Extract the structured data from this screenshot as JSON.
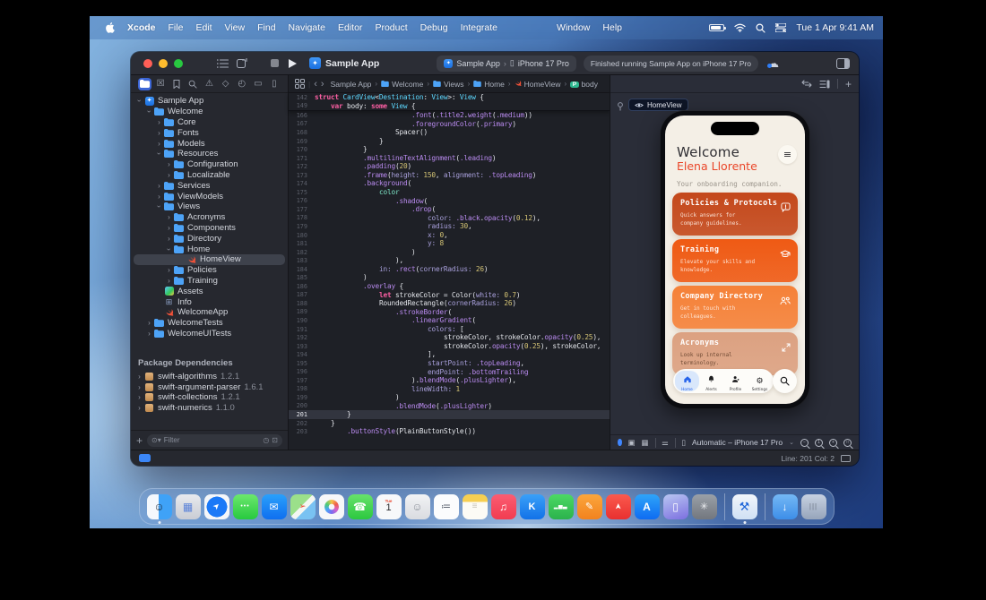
{
  "menubar": {
    "items": [
      "Xcode",
      "File",
      "Edit",
      "View",
      "Find",
      "Navigate",
      "Editor",
      "Product",
      "Debug",
      "Integrate",
      "Window",
      "Help"
    ],
    "clock": "Tue 1 Apr  9:41 AM",
    "status_icons": [
      "battery-icon",
      "wifi-icon",
      "search-icon",
      "control-center-icon"
    ]
  },
  "window": {
    "title": "Sample App",
    "toolbar": {
      "scheme_app": "Sample App",
      "scheme_device": "iPhone 17 Pro",
      "status": "Finished running Sample App on iPhone 17 Pro"
    },
    "navigator": {
      "tabs": [
        "project",
        "source-control",
        "bookmarks",
        "find",
        "issues",
        "tests",
        "debug",
        "breakpoints",
        "reports"
      ],
      "tree": [
        {
          "label": "Sample App",
          "lvl": 0,
          "disc": "open",
          "icon": "project"
        },
        {
          "label": "Welcome",
          "lvl": 1,
          "disc": "open",
          "icon": "folder"
        },
        {
          "label": "Core",
          "lvl": 2,
          "disc": "closed",
          "icon": "folder"
        },
        {
          "label": "Fonts",
          "lvl": 2,
          "disc": "closed",
          "icon": "folder"
        },
        {
          "label": "Models",
          "lvl": 2,
          "disc": "closed",
          "icon": "folder"
        },
        {
          "label": "Resources",
          "lvl": 2,
          "disc": "open",
          "icon": "folder"
        },
        {
          "label": "Configuration",
          "lvl": 3,
          "disc": "closed",
          "icon": "folder"
        },
        {
          "label": "Localizable",
          "lvl": 3,
          "disc": "closed",
          "icon": "folder"
        },
        {
          "label": "Services",
          "lvl": 2,
          "disc": "closed",
          "icon": "folder"
        },
        {
          "label": "ViewModels",
          "lvl": 2,
          "disc": "closed",
          "icon": "folder"
        },
        {
          "label": "Views",
          "lvl": 2,
          "disc": "open",
          "icon": "folder"
        },
        {
          "label": "Acronyms",
          "lvl": 3,
          "disc": "closed",
          "icon": "folder"
        },
        {
          "label": "Components",
          "lvl": 3,
          "disc": "closed",
          "icon": "folder"
        },
        {
          "label": "Directory",
          "lvl": 3,
          "disc": "closed",
          "icon": "folder"
        },
        {
          "label": "Home",
          "lvl": 3,
          "disc": "open",
          "icon": "folder"
        },
        {
          "label": "HomeView",
          "lvl": 4,
          "disc": "none",
          "icon": "swift",
          "selected": true
        },
        {
          "label": "Policies",
          "lvl": 3,
          "disc": "closed",
          "icon": "folder"
        },
        {
          "label": "Training",
          "lvl": 3,
          "disc": "closed",
          "icon": "folder"
        },
        {
          "label": "Assets",
          "lvl": 2,
          "disc": "none",
          "icon": "assets"
        },
        {
          "label": "Info",
          "lvl": 2,
          "disc": "none",
          "icon": "info"
        },
        {
          "label": "WelcomeApp",
          "lvl": 2,
          "disc": "none",
          "icon": "swift"
        },
        {
          "label": "WelcomeTests",
          "lvl": 1,
          "disc": "closed",
          "icon": "folder"
        },
        {
          "label": "WelcomeUITests",
          "lvl": 1,
          "disc": "closed",
          "icon": "folder"
        }
      ],
      "packages_header": "Package Dependencies",
      "packages": [
        {
          "label": "swift-algorithms",
          "version": "1.2.1"
        },
        {
          "label": "swift-argument-parser",
          "version": "1.6.1"
        },
        {
          "label": "swift-collections",
          "version": "1.2.1"
        },
        {
          "label": "swift-numerics",
          "version": "1.1.0"
        }
      ],
      "filter_placeholder": "Filter"
    },
    "jumpbar": {
      "crumbs": [
        {
          "icon": "project",
          "label": "Sample App"
        },
        {
          "icon": "folder",
          "label": "Welcome"
        },
        {
          "icon": "folder",
          "label": "Views"
        },
        {
          "icon": "folder",
          "label": "Home"
        },
        {
          "icon": "swift",
          "label": "HomeView"
        },
        {
          "icon": "property",
          "label": "body"
        }
      ]
    },
    "editor": {
      "current_line": 201,
      "sticky": [
        {
          "n": 142,
          "i": 0,
          "s": [
            [
              "k",
              "struct "
            ],
            [
              "t",
              "CardView"
            ],
            [
              "p",
              "<"
            ],
            [
              "t",
              "Destination"
            ],
            [
              "p",
              ": "
            ],
            [
              "t",
              "View"
            ],
            [
              "p",
              ">: "
            ],
            [
              "t",
              "View"
            ],
            [
              "p",
              " {"
            ]
          ]
        },
        {
          "n": 149,
          "i": 4,
          "s": [
            [
              "k",
              "var"
            ],
            [
              "p",
              " body: "
            ],
            [
              "k",
              "some"
            ],
            [
              "p",
              " "
            ],
            [
              "t",
              "View"
            ],
            [
              "p",
              " {"
            ]
          ]
        }
      ],
      "lines": [
        {
          "n": 166,
          "i": 24,
          "s": [
            [
              "m",
              ".font"
            ],
            [
              "p",
              "("
            ],
            [
              "m",
              ".title2"
            ],
            [
              "p",
              "."
            ],
            [
              "m",
              "weight"
            ],
            [
              "p",
              "("
            ],
            [
              "m",
              ".medium"
            ],
            [
              "p",
              "))"
            ]
          ]
        },
        {
          "n": 167,
          "i": 24,
          "s": [
            [
              "m",
              ".foregroundColor"
            ],
            [
              "p",
              "("
            ],
            [
              "m",
              ".primary"
            ],
            [
              "p",
              ")"
            ]
          ]
        },
        {
          "n": 168,
          "i": 20,
          "s": [
            [
              "p",
              "Spacer()"
            ]
          ]
        },
        {
          "n": 169,
          "i": 16,
          "s": [
            [
              "p",
              "}"
            ]
          ]
        },
        {
          "n": 170,
          "i": 12,
          "s": [
            [
              "p",
              "}"
            ]
          ]
        },
        {
          "n": 171,
          "i": 12,
          "s": [
            [
              "m",
              ".multilineTextAlignment"
            ],
            [
              "p",
              "("
            ],
            [
              "m",
              ".leading"
            ],
            [
              "p",
              ")"
            ]
          ]
        },
        {
          "n": 172,
          "i": 12,
          "s": [
            [
              "m",
              ".padding"
            ],
            [
              "p",
              "("
            ],
            [
              "n",
              "20"
            ],
            [
              "p",
              ")"
            ]
          ]
        },
        {
          "n": 173,
          "i": 12,
          "s": [
            [
              "m",
              ".frame"
            ],
            [
              "p",
              "("
            ],
            [
              "l",
              "height: "
            ],
            [
              "n",
              "150"
            ],
            [
              "p",
              ", "
            ],
            [
              "l",
              "alignment: "
            ],
            [
              "m",
              ".topLeading"
            ],
            [
              "p",
              ")"
            ]
          ]
        },
        {
          "n": 174,
          "i": 12,
          "s": [
            [
              "m",
              ".background"
            ],
            [
              "p",
              "("
            ]
          ]
        },
        {
          "n": 175,
          "i": 16,
          "s": [
            [
              "v",
              "color"
            ]
          ]
        },
        {
          "n": 176,
          "i": 20,
          "s": [
            [
              "m",
              ".shadow"
            ],
            [
              "p",
              "("
            ]
          ]
        },
        {
          "n": 177,
          "i": 24,
          "s": [
            [
              "m",
              ".drop"
            ],
            [
              "p",
              "("
            ]
          ]
        },
        {
          "n": 178,
          "i": 28,
          "s": [
            [
              "l",
              "color: "
            ],
            [
              "m",
              ".black"
            ],
            [
              "p",
              "."
            ],
            [
              "m",
              "opacity"
            ],
            [
              "p",
              "("
            ],
            [
              "n",
              "0.12"
            ],
            [
              "p",
              "),"
            ]
          ]
        },
        {
          "n": 179,
          "i": 28,
          "s": [
            [
              "l",
              "radius: "
            ],
            [
              "n",
              "30"
            ],
            [
              "p",
              ","
            ]
          ]
        },
        {
          "n": 180,
          "i": 28,
          "s": [
            [
              "l",
              "x: "
            ],
            [
              "n",
              "0"
            ],
            [
              "p",
              ","
            ]
          ]
        },
        {
          "n": 181,
          "i": 28,
          "s": [
            [
              "l",
              "y: "
            ],
            [
              "n",
              "8"
            ]
          ]
        },
        {
          "n": 182,
          "i": 24,
          "s": [
            [
              "p",
              ")"
            ]
          ]
        },
        {
          "n": 183,
          "i": 20,
          "s": [
            [
              "p",
              "),"
            ]
          ]
        },
        {
          "n": 184,
          "i": 16,
          "s": [
            [
              "l",
              "in: "
            ],
            [
              "m",
              ".rect"
            ],
            [
              "p",
              "("
            ],
            [
              "l",
              "cornerRadius: "
            ],
            [
              "n",
              "26"
            ],
            [
              "p",
              ")"
            ]
          ]
        },
        {
          "n": 185,
          "i": 12,
          "s": [
            [
              "p",
              ")"
            ]
          ]
        },
        {
          "n": 186,
          "i": 12,
          "s": [
            [
              "m",
              ".overlay"
            ],
            [
              "p",
              " {"
            ]
          ]
        },
        {
          "n": 187,
          "i": 16,
          "s": [
            [
              "k",
              "let"
            ],
            [
              "p",
              " strokeColor = Color("
            ],
            [
              "l",
              "white: "
            ],
            [
              "n",
              "0.7"
            ],
            [
              "p",
              ")"
            ]
          ]
        },
        {
          "n": 188,
          "i": 16,
          "s": [
            [
              "p",
              "RoundedRectangle("
            ],
            [
              "l",
              "cornerRadius: "
            ],
            [
              "n",
              "26"
            ],
            [
              "p",
              ")"
            ]
          ]
        },
        {
          "n": 189,
          "i": 20,
          "s": [
            [
              "m",
              ".strokeBorder"
            ],
            [
              "p",
              "("
            ]
          ]
        },
        {
          "n": 190,
          "i": 24,
          "s": [
            [
              "m",
              ".linearGradient"
            ],
            [
              "p",
              "("
            ]
          ]
        },
        {
          "n": 191,
          "i": 28,
          "s": [
            [
              "l",
              "colors: "
            ],
            [
              "p",
              "["
            ]
          ]
        },
        {
          "n": 192,
          "i": 32,
          "s": [
            [
              "p",
              "strokeColor, strokeColor."
            ],
            [
              "m",
              "opacity"
            ],
            [
              "p",
              "("
            ],
            [
              "n",
              "0.25"
            ],
            [
              "p",
              "),"
            ]
          ]
        },
        {
          "n": 193,
          "i": 32,
          "s": [
            [
              "p",
              "strokeColor."
            ],
            [
              "m",
              "opacity"
            ],
            [
              "p",
              "("
            ],
            [
              "n",
              "0.25"
            ],
            [
              "p",
              "), strokeColor,"
            ]
          ]
        },
        {
          "n": 194,
          "i": 28,
          "s": [
            [
              "p",
              "],"
            ]
          ]
        },
        {
          "n": 195,
          "i": 28,
          "s": [
            [
              "l",
              "startPoint: "
            ],
            [
              "m",
              ".topLeading"
            ],
            [
              "p",
              ","
            ]
          ]
        },
        {
          "n": 196,
          "i": 28,
          "s": [
            [
              "l",
              "endPoint: "
            ],
            [
              "m",
              ".bottomTrailing"
            ]
          ]
        },
        {
          "n": 197,
          "i": 24,
          "s": [
            [
              "p",
              ")."
            ],
            [
              "m",
              "blendMode"
            ],
            [
              "p",
              "("
            ],
            [
              "m",
              ".plusLighter"
            ],
            [
              "p",
              "),"
            ]
          ]
        },
        {
          "n": 198,
          "i": 24,
          "s": [
            [
              "l",
              "lineWidth: "
            ],
            [
              "n",
              "1"
            ]
          ]
        },
        {
          "n": 199,
          "i": 20,
          "s": [
            [
              "p",
              ")"
            ]
          ]
        },
        {
          "n": 200,
          "i": 20,
          "s": [
            [
              "m",
              ".blendMode"
            ],
            [
              "p",
              "("
            ],
            [
              "m",
              ".plusLighter"
            ],
            [
              "p",
              ")"
            ]
          ]
        },
        {
          "n": 201,
          "i": 8,
          "s": [
            [
              "p",
              "}"
            ]
          ]
        },
        {
          "n": 202,
          "i": 4,
          "s": [
            [
              "p",
              "}"
            ]
          ]
        },
        {
          "n": 203,
          "i": 8,
          "s": [
            [
              "m",
              ".buttonStyle"
            ],
            [
              "p",
              "(PlainButtonStyle())"
            ]
          ]
        }
      ]
    },
    "canvas": {
      "preview_tab": "HomeView",
      "device_label": "Automatic – iPhone 17 Pro"
    },
    "statusbar": {
      "line_col": "Line: 201  Col: 2"
    }
  },
  "phone": {
    "welcome_title": "Welcome",
    "welcome_name": "Elena Llorente",
    "subtitle": "Your onboarding companion.",
    "cards": [
      {
        "title": "Policies & Protocols",
        "subtitle": "Quick answers for company guidelines.",
        "icon": "chat-alert-icon",
        "bg": "#c4481b",
        "variant": "dark"
      },
      {
        "title": "Training",
        "subtitle": "Elevate your skills and knowledge.",
        "icon": "graduation-cap-icon",
        "bg": "#ef5a14",
        "variant": "dark"
      },
      {
        "title": "Company Directory",
        "subtitle": "Get in touch with colleagues.",
        "icon": "people-icon",
        "bg": "#f58138",
        "variant": "dark"
      },
      {
        "title": "Acronyms",
        "subtitle": "Look up internal terminology.",
        "icon": "expand-icon",
        "bg": "#dca181",
        "variant": "tan"
      }
    ],
    "tabs": [
      {
        "label": "Home",
        "icon": "home-icon",
        "active": true
      },
      {
        "label": "Alerts",
        "icon": "bell-icon",
        "active": false
      },
      {
        "label": "Profile",
        "icon": "person-icon",
        "active": false
      },
      {
        "label": "Settings",
        "icon": "gear-icon",
        "active": false
      }
    ]
  },
  "dock": {
    "items": [
      {
        "name": "finder",
        "running": true
      },
      {
        "name": "launchpad"
      },
      {
        "name": "safari"
      },
      {
        "name": "messages"
      },
      {
        "name": "mail"
      },
      {
        "name": "maps"
      },
      {
        "name": "photos"
      },
      {
        "name": "phone"
      },
      {
        "name": "calendar"
      },
      {
        "name": "contacts"
      },
      {
        "name": "reminders"
      },
      {
        "name": "notes"
      },
      {
        "name": "music"
      },
      {
        "name": "keynote"
      },
      {
        "name": "numbers"
      },
      {
        "name": "pages"
      },
      {
        "name": "rocket"
      },
      {
        "name": "appstore"
      },
      {
        "name": "simulator"
      },
      {
        "name": "symbols"
      },
      {
        "divider": true
      },
      {
        "name": "xcode",
        "running": true
      },
      {
        "divider": true
      },
      {
        "name": "downloads"
      },
      {
        "name": "trash"
      }
    ]
  }
}
